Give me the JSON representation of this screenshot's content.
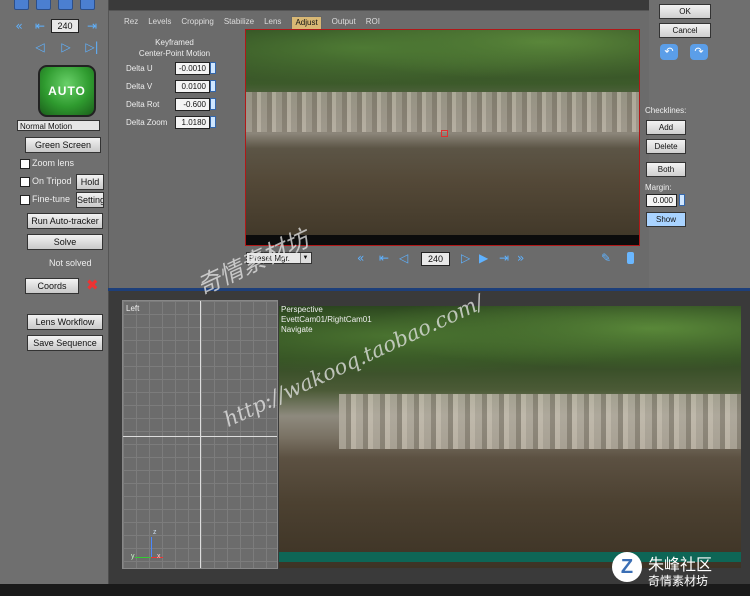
{
  "left_panel": {
    "frame": "240",
    "auto_label": "AUTO",
    "mode_select": "Normal Motion",
    "green_screen": "Green Screen",
    "zoom_lens": "Zoom lens",
    "on_tripod": "On Tripod",
    "hold": "Hold",
    "fine_tune": "Fine-tune",
    "settings": "Settings",
    "run_autotracker": "Run Auto-tracker",
    "solve": "Solve",
    "status": "Not solved",
    "coords": "Coords",
    "lens_workflow": "Lens Workflow",
    "save_sequence": "Save Sequence"
  },
  "dialog": {
    "tabs": [
      "Rez",
      "Levels",
      "Cropping",
      "Stabilize",
      "Lens",
      "Adjust",
      "Output",
      "ROI"
    ],
    "active_tab": "Adjust",
    "section_title_1": "Keyframed",
    "section_title_2": "Center-Point Motion",
    "fields": [
      {
        "label": "Delta U",
        "value": "-0.0010"
      },
      {
        "label": "Delta V",
        "value": "0.0100"
      },
      {
        "label": "Delta Rot",
        "value": "-0.600"
      },
      {
        "label": "Delta Zoom",
        "value": "1.0180"
      }
    ],
    "preset": "Preset Mgr.",
    "frame": "240"
  },
  "right_panel": {
    "ok": "OK",
    "cancel": "Cancel",
    "checklines_label": "Checklines:",
    "add": "Add",
    "delete": "Delete",
    "both": "Both",
    "margin_label": "Margin:",
    "margin_value": "0.000",
    "show": "Show"
  },
  "viewports": {
    "left_label": "Left",
    "persp_label_1": "Perspective",
    "persp_label_2": "EvettCam01/RightCam01",
    "persp_label_3": "Navigate",
    "axis_z": "z",
    "axis_y": "y",
    "axis_x": "x"
  },
  "watermarks": {
    "line1": "奇情素材坊",
    "line2": "http://wakooq.taobao.com/",
    "corner_1": "朱峰社区",
    "corner_2": "奇情素材坊"
  },
  "colors": {
    "accent": "#5fb2ff",
    "active_tab": "#d9b875",
    "preview_border": "#b01818"
  }
}
